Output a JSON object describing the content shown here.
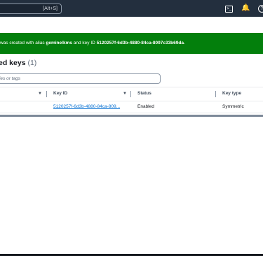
{
  "topbar": {
    "search_shortcut": "[Alt+S]",
    "icons": [
      "cloudshell-icon",
      "bell-icon",
      "help-icon"
    ]
  },
  "banner": {
    "prefix": "was created with alias ",
    "alias": "geminelkms",
    "middle": " and key ID ",
    "key_id": "5120257f-6d3b-4880-84ca-8097c33b69da",
    "suffix": ".",
    "color": "#037f0c"
  },
  "section": {
    "title": "ed keys",
    "count": "(1)"
  },
  "filter": {
    "placeholder": "rties or tags"
  },
  "table": {
    "columns": [
      "Key ID",
      "Status",
      "Key type"
    ],
    "rows": [
      {
        "key_id": "5120257f-6d3b-4880-84ca-809...",
        "status": "Enabled",
        "key_type": "Symmetric"
      }
    ]
  }
}
